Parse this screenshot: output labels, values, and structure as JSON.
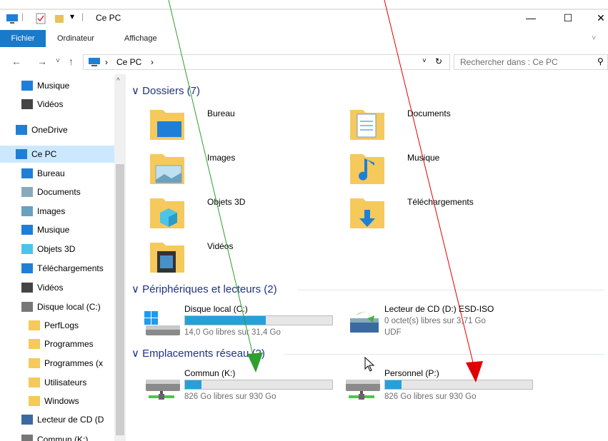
{
  "window": {
    "title": "Ce PC",
    "qa_separator": "|",
    "qa_dropdown": "▾",
    "min": "—",
    "max": "☐",
    "close": "✕"
  },
  "ribbon": {
    "file": "Fichier",
    "computer": "Ordinateur",
    "view": "Affichage",
    "expand": "˅"
  },
  "nav": {
    "back": "←",
    "forward": "→",
    "recent": "˅",
    "up": "↑",
    "breadcrumb": "›",
    "path": "Ce PC",
    "path_sep": "›",
    "dropdown": "˅",
    "refresh": "↻",
    "search_placeholder": "Rechercher dans : Ce PC",
    "search_icon": "⚲"
  },
  "sidebar": {
    "collapse": "^",
    "items": [
      {
        "label": "Musique",
        "icon": "music-icon"
      },
      {
        "label": "Vidéos",
        "icon": "video-icon"
      },
      {
        "label": "OneDrive",
        "icon": "cloud-icon"
      },
      {
        "label": "Ce PC",
        "icon": "pc-icon",
        "selected": true
      },
      {
        "label": "Bureau",
        "icon": "desktop-icon"
      },
      {
        "label": "Documents",
        "icon": "documents-icon"
      },
      {
        "label": "Images",
        "icon": "images-icon"
      },
      {
        "label": "Musique",
        "icon": "music-icon"
      },
      {
        "label": "Objets 3D",
        "icon": "cube-icon"
      },
      {
        "label": "Téléchargements",
        "icon": "download-icon"
      },
      {
        "label": "Vidéos",
        "icon": "video-icon"
      },
      {
        "label": "Disque local (C:)",
        "icon": "drive-icon"
      },
      {
        "label": "PerfLogs",
        "icon": "folder-icon"
      },
      {
        "label": "Programmes",
        "icon": "folder-icon"
      },
      {
        "label": "Programmes (x",
        "icon": "folder-icon"
      },
      {
        "label": "Utilisateurs",
        "icon": "folder-icon"
      },
      {
        "label": "Windows",
        "icon": "folder-icon"
      },
      {
        "label": "Lecteur de CD (D",
        "icon": "cd-icon"
      },
      {
        "label": "Commun (K:)",
        "icon": "network-drive-icon"
      }
    ]
  },
  "groups": {
    "folders": {
      "toggle": "∨",
      "label": "Dossiers (7)"
    },
    "devices": {
      "toggle": "∨",
      "label": "Périphériques et lecteurs (2)"
    },
    "network": {
      "toggle": "∨",
      "label": "Emplacements réseau (2)"
    }
  },
  "folders": [
    {
      "name": "Bureau",
      "icon": "desktop-icon"
    },
    {
      "name": "Documents",
      "icon": "documents-icon"
    },
    {
      "name": "Images",
      "icon": "images-icon"
    },
    {
      "name": "Musique",
      "icon": "music-icon"
    },
    {
      "name": "Objets 3D",
      "icon": "cube-icon"
    },
    {
      "name": "Téléchargements",
      "icon": "download-icon"
    },
    {
      "name": "Vidéos",
      "icon": "video-icon"
    }
  ],
  "devices": [
    {
      "name": "Disque local (C:)",
      "free": "14,0 Go libres sur 31,4 Go",
      "used_fraction": 0.55,
      "icon": "windows-drive-icon"
    },
    {
      "name": "Lecteur de CD (D:) ESD-ISO",
      "free": "0 octet(s) libres sur 3,71 Go",
      "fs": "UDF",
      "icon": "cd-drive-icon"
    }
  ],
  "network": [
    {
      "name": "Commun (K:)",
      "free": "826 Go libres sur 930 Go",
      "used_fraction": 0.11,
      "icon": "network-drive-icon"
    },
    {
      "name": "Personnel (P:)",
      "free": "826 Go libres sur 930 Go",
      "used_fraction": 0.11,
      "icon": "network-drive-icon"
    }
  ],
  "colors": {
    "accent": "#1979ca",
    "bar": "#26a0da",
    "green_arrow": "#2e9e2e",
    "red_arrow": "#e00000"
  }
}
